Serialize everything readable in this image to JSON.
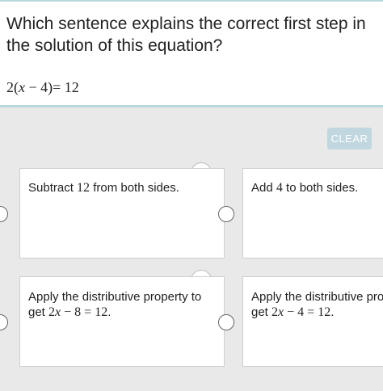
{
  "question": {
    "text": "Which sentence explains the correct first step in the solution of this equation?",
    "equation": "2(x − 4)= 12"
  },
  "clear_label": "CLEAR",
  "options": [
    {
      "prefix": "Subtract ",
      "math": "12",
      "suffix": " from both sides.",
      "line2": ""
    },
    {
      "prefix": "Add ",
      "math": "4",
      "suffix": " to both sides.",
      "line2": ""
    },
    {
      "prefix": "Apply the distributive property to",
      "math": "",
      "suffix": "",
      "line2": "get 2x − 8 = 12."
    },
    {
      "prefix": "Apply the distributive prop",
      "math": "",
      "suffix": "",
      "line2": "get 2x − 4 = 12."
    }
  ],
  "icons": {
    "audio": "speaker-icon",
    "radio": "radio-button"
  },
  "colors": {
    "background": "#e9e9e9",
    "accent": "#b9d8dc",
    "clear_button": "#c1d7df"
  }
}
